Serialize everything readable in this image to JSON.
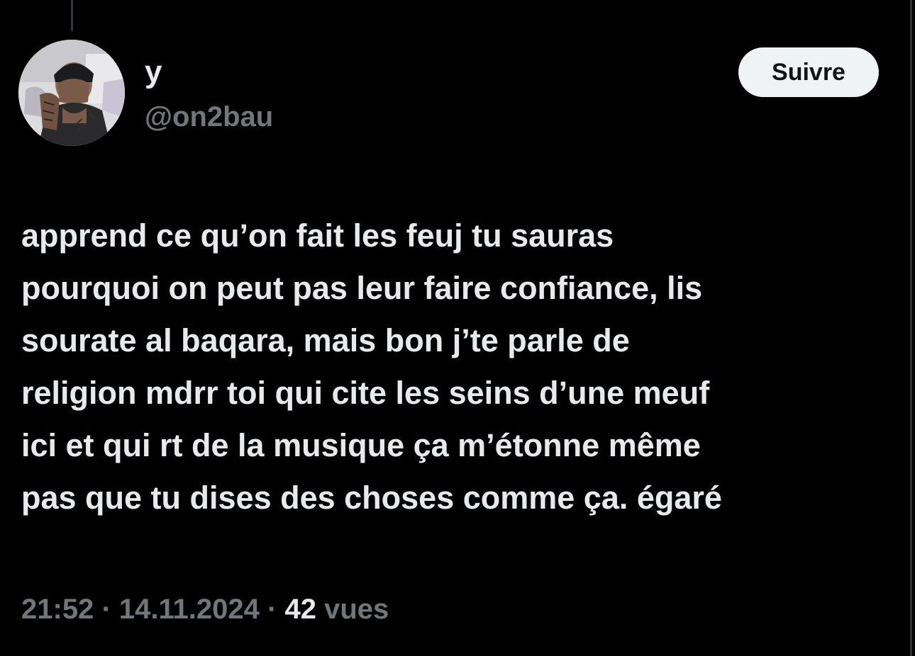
{
  "author": {
    "display_name": "y",
    "handle": "@on2bau"
  },
  "actions": {
    "follow_label": "Suivre"
  },
  "tweet": {
    "lines": [
      "apprend ce qu’on fait les feuj tu sauras",
      "pourquoi on peut pas leur faire confiance, lis",
      "sourate al baqara, mais bon j’te parle de",
      "religion mdrr toi qui cite les seins d’une meuf",
      "ici et qui rt de la musique ça m’étonne même",
      "pas que tu dises des choses comme ça. égaré"
    ]
  },
  "meta": {
    "time": "21:52",
    "separator": "·",
    "date": "14.11.2024",
    "views_count": "42",
    "views_label": "vues"
  },
  "colors": {
    "background": "#000000",
    "primary_text": "#e7e9ea",
    "secondary_text": "#71767b",
    "button_bg": "#eff3f4",
    "button_text": "#0f1419"
  }
}
